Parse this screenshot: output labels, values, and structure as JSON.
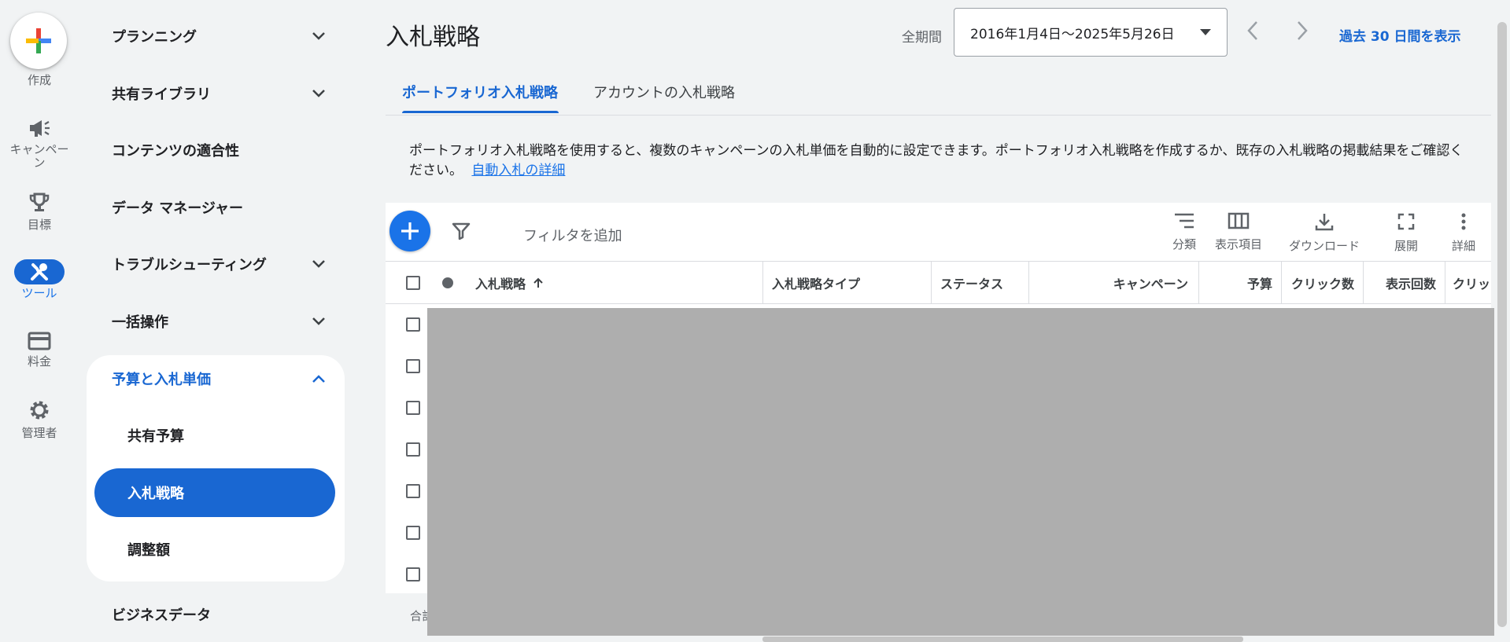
{
  "rail": {
    "create": "作成",
    "campaigns": "キャンペーン",
    "goals": "目標",
    "tools": "ツール",
    "billing": "料金",
    "admin": "管理者"
  },
  "nav": {
    "planning": "プランニング",
    "shared_library": "共有ライブラリ",
    "content_suitability": "コンテンツの適合性",
    "data_manager": "データ マネージャー",
    "troubleshooting": "トラブルシューティング",
    "bulk_actions": "一括操作",
    "budgets_bids": "予算と入札単価",
    "shared_budgets": "共有予算",
    "bid_strategies": "入札戦略",
    "adjustments": "調整額",
    "business_data": "ビジネスデータ"
  },
  "header": {
    "title": "入札戦略",
    "date_label": "全期間",
    "date_range": "2016年1月4日～2025年5月26日",
    "last_30": "過去 30 日間を表示"
  },
  "tabs": [
    "ポートフォリオ入札戦略",
    "アカウントの入札戦略"
  ],
  "description": {
    "text": "ポートフォリオ入札戦略を使用すると、複数のキャンペーンの入札単価を自動的に設定できます。ポートフォリオ入札戦略を作成するか、既存の入札戦略の掲載結果をご確認ください。",
    "link": "自動入札の詳細"
  },
  "toolbar": {
    "filter": "フィルタを追加",
    "segment": "分類",
    "columns": "表示項目",
    "download": "ダウンロード",
    "expand": "展開",
    "more": "詳細"
  },
  "table": {
    "columns": [
      "入札戦略",
      "入札戦略タイプ",
      "ステータス",
      "キャンペーン",
      "予算",
      "クリック数",
      "表示回数",
      "クリッ"
    ],
    "total_label": "合計"
  },
  "colors": {
    "accent": "#1967d2",
    "fab": "#1a73e8",
    "background": "#f1f3f4",
    "redaction": "#aeaeae"
  }
}
